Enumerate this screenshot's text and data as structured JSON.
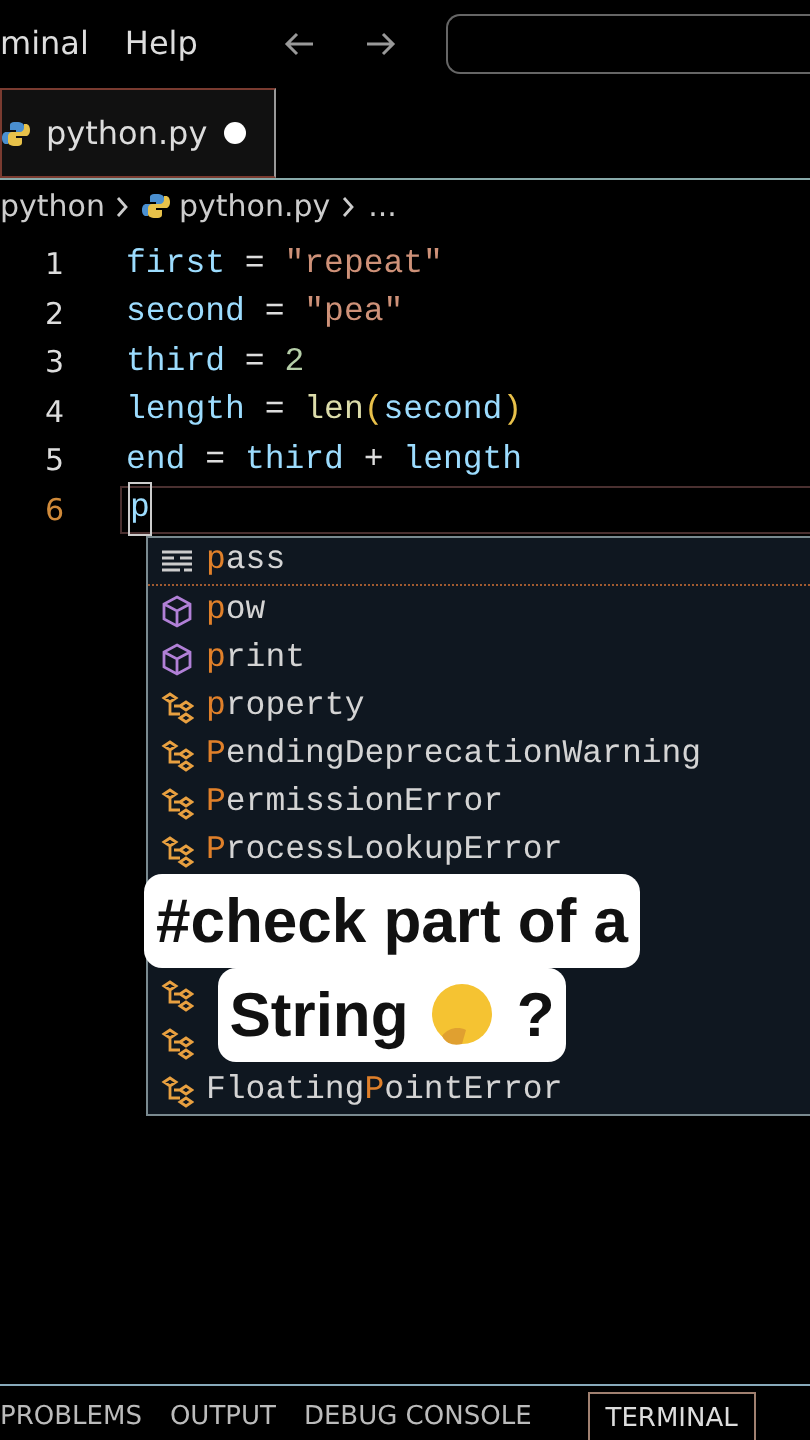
{
  "menu": [
    "minal",
    "Help"
  ],
  "tabs": [
    {
      "label": "python.py",
      "selected": true,
      "modified": true
    }
  ],
  "breadcrumb": [
    "python",
    "python.py",
    "..."
  ],
  "code": [
    {
      "number": "1",
      "active": false,
      "tokens": [
        {
          "kind": "var",
          "text": "first"
        },
        {
          "kind": "op",
          "text": " = "
        },
        {
          "kind": "str",
          "text": "\"repeat\""
        }
      ]
    },
    {
      "number": "2",
      "active": false,
      "tokens": [
        {
          "kind": "var",
          "text": "second"
        },
        {
          "kind": "op",
          "text": " = "
        },
        {
          "kind": "str",
          "text": "\"pea\""
        }
      ]
    },
    {
      "number": "3",
      "active": false,
      "tokens": [
        {
          "kind": "var",
          "text": "third"
        },
        {
          "kind": "op",
          "text": " = "
        },
        {
          "kind": "num",
          "text": "2"
        }
      ]
    },
    {
      "number": "4",
      "active": false,
      "tokens": [
        {
          "kind": "var",
          "text": "length"
        },
        {
          "kind": "op",
          "text": " = "
        },
        {
          "kind": "func",
          "text": "len"
        },
        {
          "kind": "paren",
          "text": "("
        },
        {
          "kind": "var",
          "text": "second"
        },
        {
          "kind": "paren",
          "text": ")"
        }
      ]
    },
    {
      "number": "5",
      "active": false,
      "tokens": [
        {
          "kind": "var",
          "text": "end"
        },
        {
          "kind": "op",
          "text": " = "
        },
        {
          "kind": "var",
          "text": "third"
        },
        {
          "kind": "op",
          "text": " + "
        },
        {
          "kind": "var",
          "text": "length"
        }
      ]
    },
    {
      "number": "6",
      "active": true,
      "tokens": [
        {
          "kind": "var",
          "text": "p"
        }
      ]
    }
  ],
  "suggestions": [
    {
      "kind": "keyword",
      "selected": true,
      "match": "p",
      "after": "ass"
    },
    {
      "kind": "function",
      "selected": false,
      "match": "p",
      "after": "ow"
    },
    {
      "kind": "function",
      "selected": false,
      "match": "p",
      "after": "rint"
    },
    {
      "kind": "class",
      "selected": false,
      "match": "p",
      "after": "roperty"
    },
    {
      "kind": "class",
      "selected": false,
      "match": "P",
      "after": "endingDeprecationWarning"
    },
    {
      "kind": "class",
      "selected": false,
      "match": "P",
      "after": "ermissionError"
    },
    {
      "kind": "class",
      "selected": false,
      "match": "P",
      "after": "rocessLookupError"
    },
    {
      "kind": "class",
      "selected": false
    },
    {
      "kind": "class",
      "selected": false
    },
    {
      "kind": "class",
      "selected": false,
      "before": "Floating",
      "match": "P",
      "after": "ointError"
    }
  ],
  "caption": [
    "#check part of a",
    "String",
    "?"
  ],
  "panel_tabs": [
    {
      "label": "PROBLEMS",
      "selected": false
    },
    {
      "label": "OUTPUT",
      "selected": false
    },
    {
      "label": "DEBUG CONSOLE",
      "selected": false
    },
    {
      "label": "TERMINAL",
      "selected": true
    }
  ]
}
